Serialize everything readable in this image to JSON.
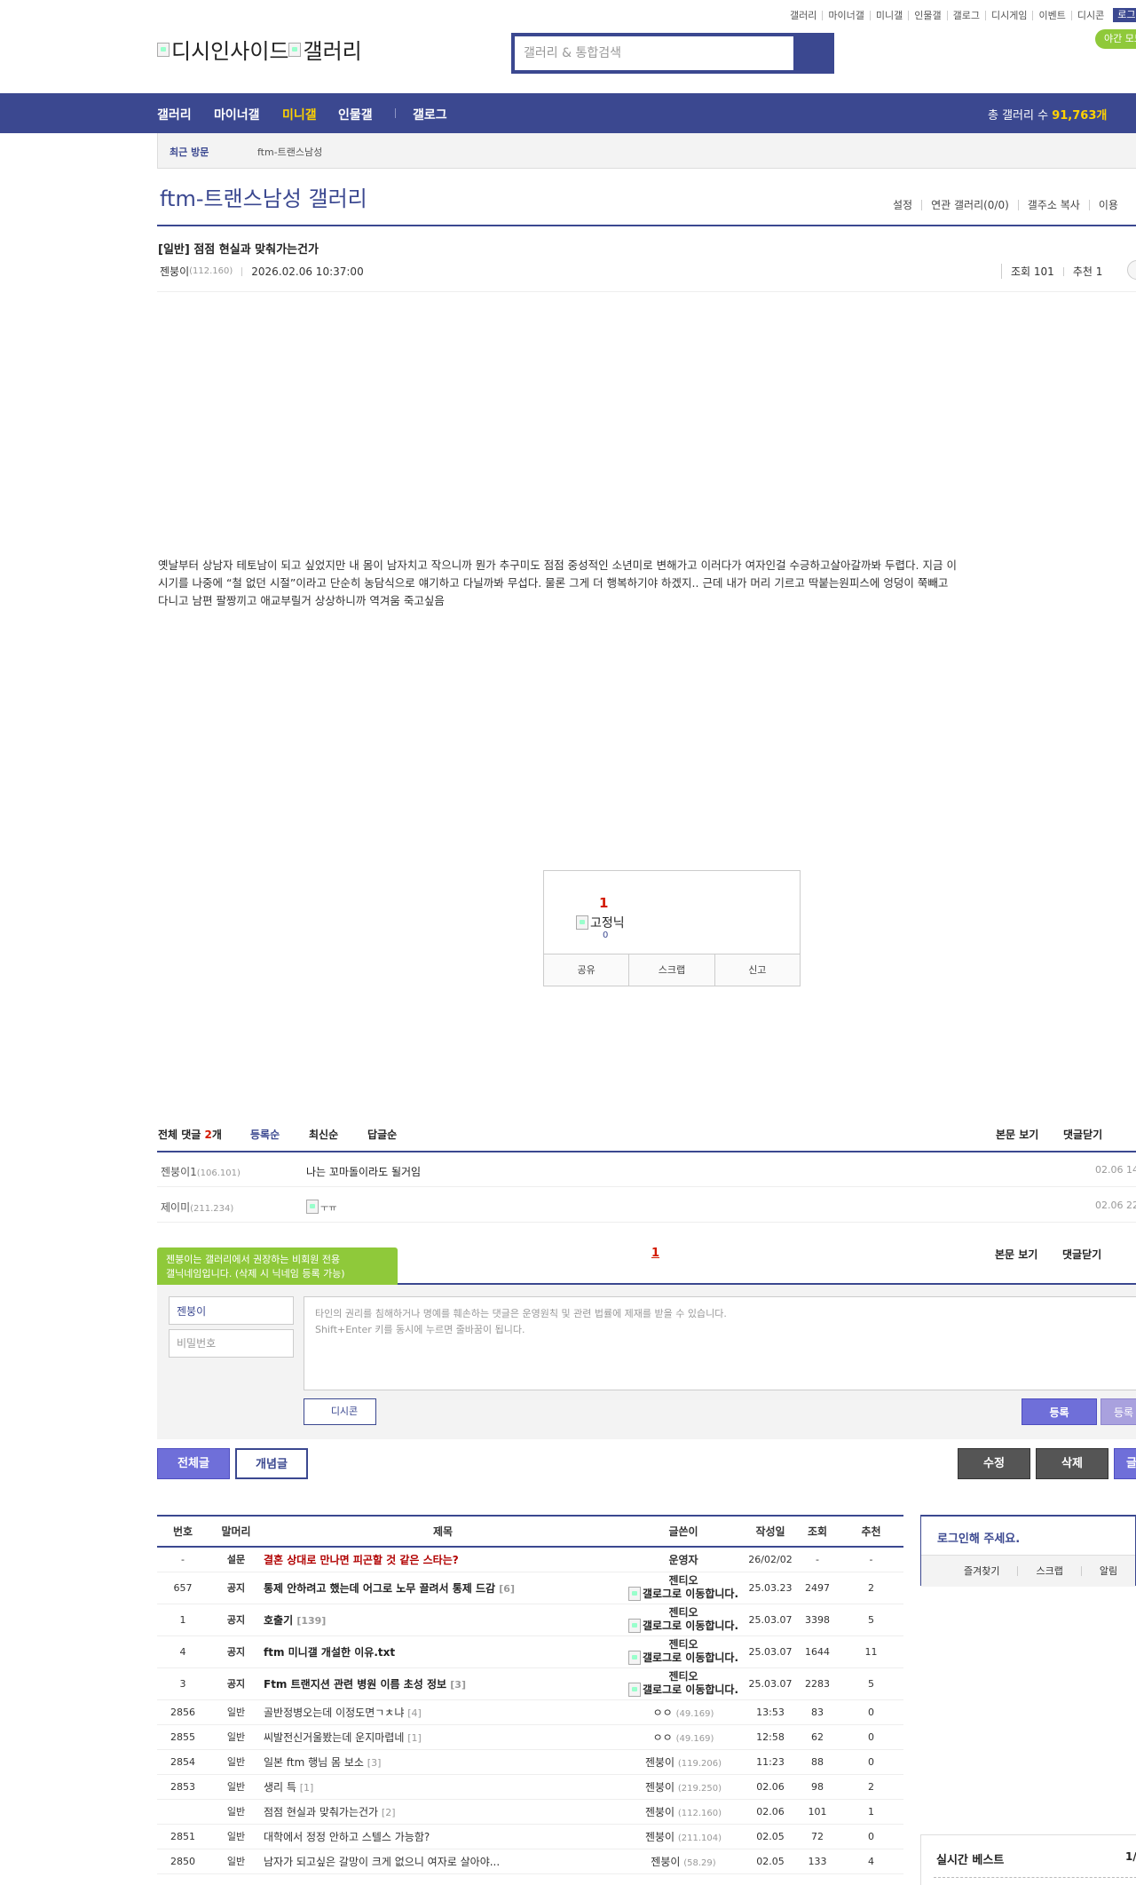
{
  "top_links": [
    "갤러리",
    "마이너갤",
    "미니갤",
    "인물갤",
    "갤로그",
    "디시게임",
    "이벤트",
    "디시콘"
  ],
  "login_label": "로그인",
  "night_mode_label": "야간 모드",
  "logo": {
    "part1": "디시인사이드",
    "part2": "갤러리"
  },
  "search": {
    "placeholder": "갤러리 & 통합검색"
  },
  "nav": {
    "items": [
      "갤러리",
      "마이너갤",
      "미니갤",
      "인물갤",
      "갤로그"
    ],
    "active": "미니갤",
    "total_prefix": "총 갤러리 수",
    "total_value": "91,763개"
  },
  "recent": {
    "label": "최근 방문",
    "item": "ftm-트랜스남성"
  },
  "gallery": {
    "title": "ftm-트랜스남성 갤러리",
    "links": [
      "설정",
      "연관 갤러리(0/0)",
      "갤주소 복사",
      "이용"
    ]
  },
  "post": {
    "title": "[일반] 점점 현실과 맞춰가는건가",
    "author": "젠붕이",
    "ip": "(112.160)",
    "datetime": "2026.02.06 10:37:00",
    "views_label": "조회 101",
    "recs_label": "추천 1",
    "body": "옛날부터 상남자 테토남이 되고 싶었지만 내 몸이 남자치고 작으니까 뭔가 추구미도 점점 중성적인 소년미로 변해가고 이러다가 여자인걸 수긍하고살아갈까봐 두렵다. 지금 이 시기를 나중에 “철 없던 시절”이라고 단순히 농담식으로 얘기하고 다닐까봐 무섭다. 물론 그게 더 행복하기야 하겠지.. 근데 내가 머리 기르고 딱붙는원피스에 엉덩이 쭉빼고 다니고 남편 팔짱끼고 애교부릴거 상상하니까 역겨움 죽고싶음"
  },
  "recommend": {
    "count": "1",
    "nick": "고정닉",
    "nick_count": "0",
    "actions": [
      "공유",
      "스크랩",
      "신고"
    ]
  },
  "comments": {
    "total_label": "전체 댓글",
    "total_count": "2",
    "total_unit": "개",
    "sorts": [
      "등록순",
      "최신순",
      "답글순"
    ],
    "view_post": "본문 보기",
    "close": "댓글닫기",
    "items": [
      {
        "nick": "젠붕이1",
        "ip": "(106.101)",
        "text": "나는 꼬마돌이라도 될거임",
        "date": "02.06 14"
      },
      {
        "nick": "제이미",
        "ip": "(211.234)",
        "text": "ㅜㅠ",
        "date": "02.06 22"
      }
    ],
    "page": "1"
  },
  "tooltip": {
    "line1": "젠붕이는 갤러리에서 권장하는 비회원 전용",
    "line2": "갤닉네임입니다. (삭제 시 닉네임 등록 가능)"
  },
  "write": {
    "nick_value": "젠붕이",
    "pw_placeholder": "비밀번호",
    "textarea_placeholder": "타인의 권리를 침해하거나 명예를 훼손하는 댓글은 운영원칙 및 관련 법률에 제재를 받을 수 있습니다.\nShift+Enter 키를 동시에 누르면 줄바꿈이 됩니다.",
    "dccon": "디시콘",
    "submit": "등록",
    "submit2": "등록"
  },
  "buttons": {
    "all": "전체글",
    "concept": "개념글",
    "edit": "수정",
    "delete": "삭제",
    "write": "글"
  },
  "list": {
    "headers": [
      "번호",
      "말머리",
      "제목",
      "글쓴이",
      "작성일",
      "조회",
      "추천"
    ],
    "gallog_text": "갤로그로 이동합니다.",
    "rows": [
      {
        "no": "-",
        "kind": "설문",
        "title": "결혼 상대로 만나면 피곤할 것 같은 스타는?",
        "rc": "",
        "writer": "운영자",
        "ip": "",
        "date": "26/02/02",
        "views": "-",
        "recs": "-"
      },
      {
        "no": "657",
        "kind": "공지",
        "title": "통제 안하려고 했는데 어그로 노무 끌려서 통제 드감",
        "rc": "[6]",
        "writer": "젠티오",
        "ip": "",
        "date": "25.03.23",
        "views": "2497",
        "recs": "2"
      },
      {
        "no": "1",
        "kind": "공지",
        "title": "호출기",
        "rc": "[139]",
        "writer": "젠티오",
        "ip": "",
        "date": "25.03.07",
        "views": "3398",
        "recs": "5"
      },
      {
        "no": "4",
        "kind": "공지",
        "title": "ftm 미니갤 개설한 이유.txt",
        "rc": "",
        "writer": "젠티오",
        "ip": "",
        "date": "25.03.07",
        "views": "1644",
        "recs": "11"
      },
      {
        "no": "3",
        "kind": "공지",
        "title": "Ftm 트랜지션 관련 병원 이름 초성 정보",
        "rc": "[3]",
        "writer": "젠티오",
        "ip": "",
        "date": "25.03.07",
        "views": "2283",
        "recs": "5"
      },
      {
        "no": "2856",
        "kind": "일반",
        "title": "골반정병오는데 이정도면ㄱㅊ냐",
        "rc": "[4]",
        "writer": "ㅇㅇ",
        "ip": "(49.169)",
        "date": "13:53",
        "views": "83",
        "recs": "0"
      },
      {
        "no": "2855",
        "kind": "일반",
        "title": "씨발전신거울봤는데 운지마렵네",
        "rc": "[1]",
        "writer": "ㅇㅇ",
        "ip": "(49.169)",
        "date": "12:58",
        "views": "62",
        "recs": "0"
      },
      {
        "no": "2854",
        "kind": "일반",
        "title": "일본 ftm 행님 몸 보소",
        "rc": "[3]",
        "writer": "젠붕이",
        "ip": "(119.206)",
        "date": "11:23",
        "views": "88",
        "recs": "0"
      },
      {
        "no": "2853",
        "kind": "일반",
        "title": "생리 특",
        "rc": "[1]",
        "writer": "젠붕이",
        "ip": "(219.250)",
        "date": "02.06",
        "views": "98",
        "recs": "2"
      },
      {
        "no": "",
        "kind": "일반",
        "title": "점점 현실과 맞춰가는건가",
        "rc": "[2]",
        "writer": "젠붕이",
        "ip": "(112.160)",
        "date": "02.06",
        "views": "101",
        "recs": "1"
      },
      {
        "no": "2851",
        "kind": "일반",
        "title": "대학에서 정정 안하고 스텔스 가능함?",
        "rc": "",
        "writer": "젠붕이",
        "ip": "(211.104)",
        "date": "02.05",
        "views": "72",
        "recs": "0"
      },
      {
        "no": "2850",
        "kind": "일반",
        "title": "남자가 되고싶은 갈망이 크게 없으니 여자로 살아야...",
        "rc": "",
        "writer": "젠붕이",
        "ip": "(58.29)",
        "date": "02.05",
        "views": "133",
        "recs": "4"
      }
    ]
  },
  "login_box": {
    "title": "로그인해 주세요.",
    "links": [
      "즐겨찾기",
      "스크랩",
      "알림"
    ]
  },
  "best_box": {
    "title": "실시간 베스트",
    "page": "1/"
  },
  "colors": {
    "brand": "#3b4890",
    "accent_yellow": "#ffd200",
    "green": "#8fc93a",
    "red": "#d31900"
  }
}
